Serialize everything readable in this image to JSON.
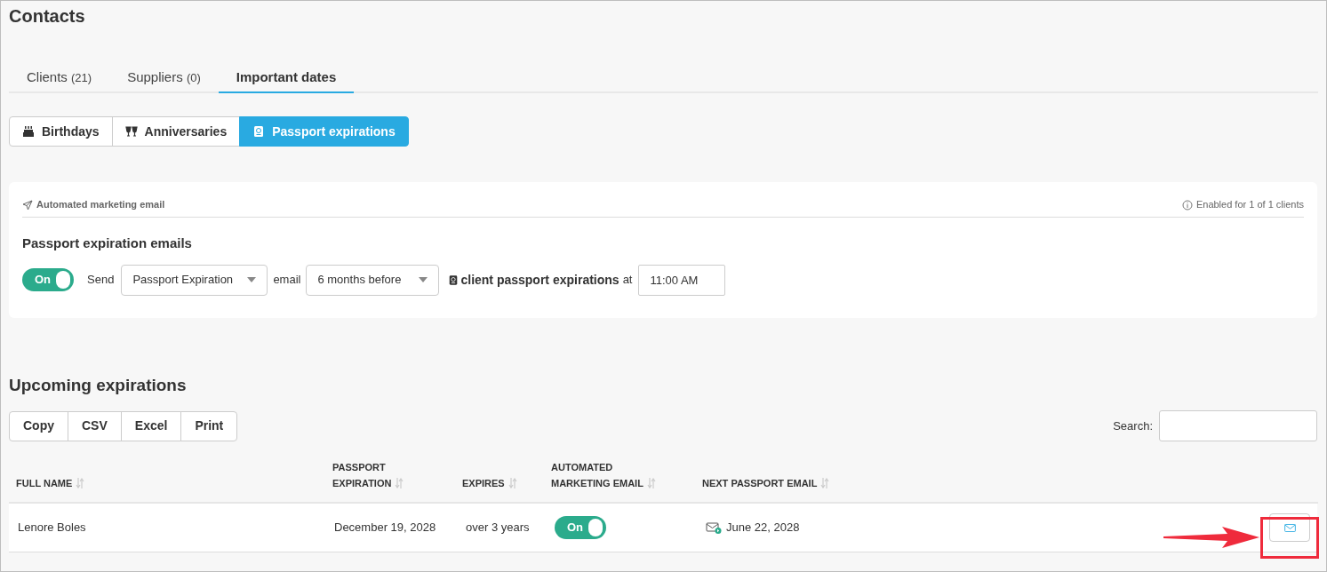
{
  "page_title": "Contacts",
  "tabs": [
    {
      "label": "Clients",
      "count": "(21)",
      "selected": false
    },
    {
      "label": "Suppliers",
      "count": "(0)",
      "selected": false
    },
    {
      "label": "Important dates",
      "selected": true
    }
  ],
  "segments": [
    {
      "label": "Birthdays",
      "kind": "cake",
      "selected": false
    },
    {
      "label": "Anniversaries",
      "kind": "glasses",
      "selected": false
    },
    {
      "label": "Passport expirations",
      "kind": "passport",
      "selected": true
    }
  ],
  "card": {
    "caption": "Automated marketing email",
    "enabled_note": "Enabled for 1 of 1 clients",
    "heading": "Passport expiration emails",
    "toggle": {
      "label": "On",
      "on": true
    },
    "send_label": "Send",
    "template": "Passport Expiration",
    "email_label": "email",
    "timing": "6 months before",
    "subject": "client passport expirations",
    "at_label": "at",
    "time": "11:00 AM"
  },
  "section_title": "Upcoming expirations",
  "export_buttons": [
    "Copy",
    "CSV",
    "Excel",
    "Print"
  ],
  "search_label": "Search:",
  "table": {
    "columns": [
      [
        "FULL NAME"
      ],
      [
        "PASSPORT",
        "EXPIRATION"
      ],
      [
        "EXPIRES"
      ],
      [
        "AUTOMATED",
        "MARKETING EMAIL"
      ],
      [
        "NEXT PASSPORT EMAIL"
      ]
    ],
    "rows": [
      {
        "name": "Lenore Boles",
        "expiration": "December 19, 2028",
        "expires": "over 3 years",
        "toggle": {
          "label": "On",
          "on": true
        },
        "next_email": "June 22, 2028"
      }
    ]
  }
}
